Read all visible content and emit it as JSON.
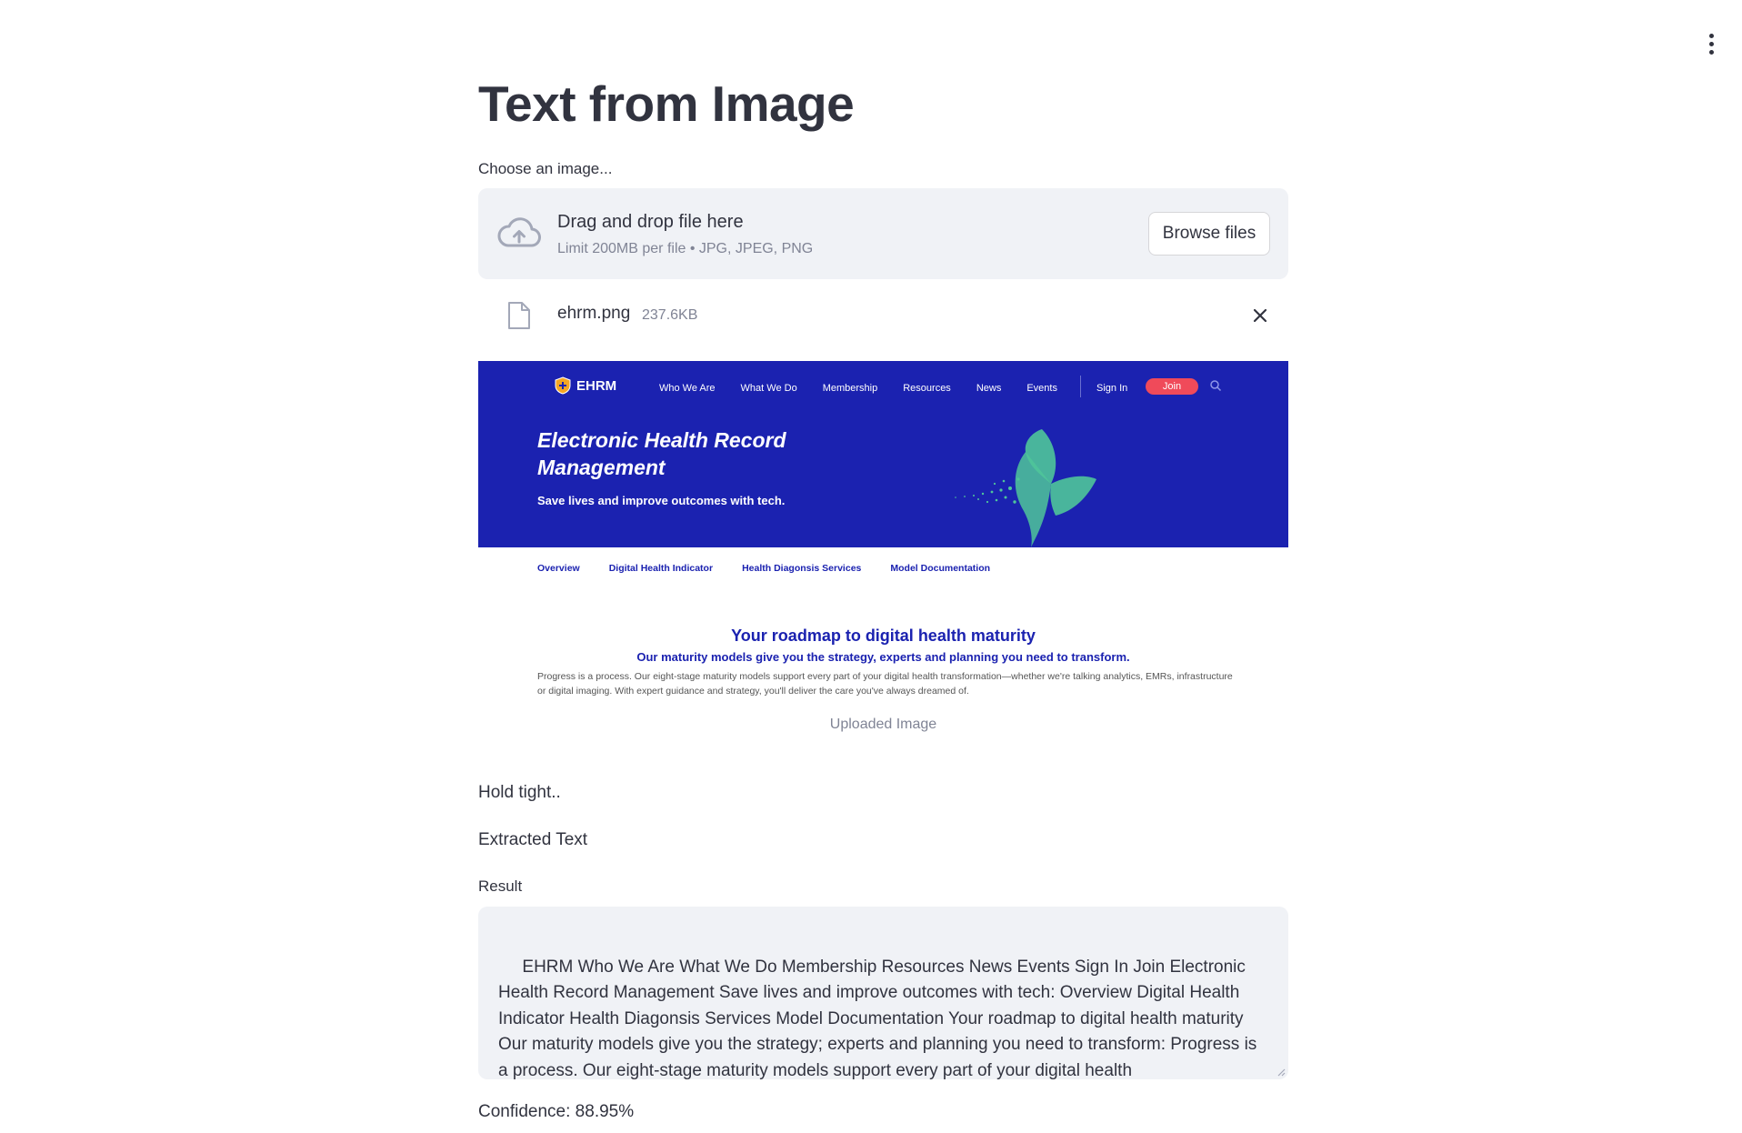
{
  "page": {
    "title": "Text from Image"
  },
  "uploader": {
    "label": "Choose an image...",
    "drop_title": "Drag and drop file here",
    "drop_subtitle": "Limit 200MB per file • JPG, JPEG, PNG",
    "browse_label": "Browse files"
  },
  "file": {
    "name": "ehrm.png",
    "size": "237.6KB"
  },
  "preview": {
    "logo": "EHRM",
    "nav": [
      "Who We Are",
      "What We Do",
      "Membership",
      "Resources",
      "News",
      "Events"
    ],
    "sign_in": "Sign In",
    "join": "Join",
    "hero_title": "Electronic Health Record Management",
    "hero_subtitle": "Save lives and improve outcomes with tech.",
    "subnav": [
      "Overview",
      "Digital Health Indicator",
      "Health Diagonsis Services",
      "Model Documentation"
    ],
    "roadmap_title": "Your roadmap to digital health maturity",
    "roadmap_subtitle": "Our maturity models give you the strategy, experts and planning you need to transform.",
    "roadmap_body": "Progress is a process. Our eight-stage maturity models support every part of your digital health transformation—whether we're talking analytics, EMRs, infrastructure or digital imaging. With expert guidance and strategy, you'll deliver the care you've always dreamed of.",
    "caption": "Uploaded Image",
    "colors": {
      "hero_bg": "#1b22b0",
      "join_bg": "#f04a5a",
      "butterfly": "#4fc59a"
    }
  },
  "status": {
    "hold": "Hold tight..",
    "extracted": "Extracted Text"
  },
  "result": {
    "label": "Result",
    "text": " EHRM Who We Are What We Do Membership Resources News Events Sign In Join Electronic Health Record Management Save lives and improve outcomes with tech: Overview Digital Health Indicator Health Diagonsis Services Model Documentation Your roadmap to digital health maturity Our maturity models give you the strategy; experts and planning you need to transform: Progress is a process. Our eight-stage maturity models support every part of your digital health transformation__whether we're talking analytics, EMRs, infrastructure or digital imaging: With expert"
  },
  "confidence": "Confidence: 88.95%",
  "icons": {
    "menu": "kebab-menu-icon",
    "upload": "cloud-upload-icon",
    "file": "file-icon",
    "close": "close-icon"
  }
}
